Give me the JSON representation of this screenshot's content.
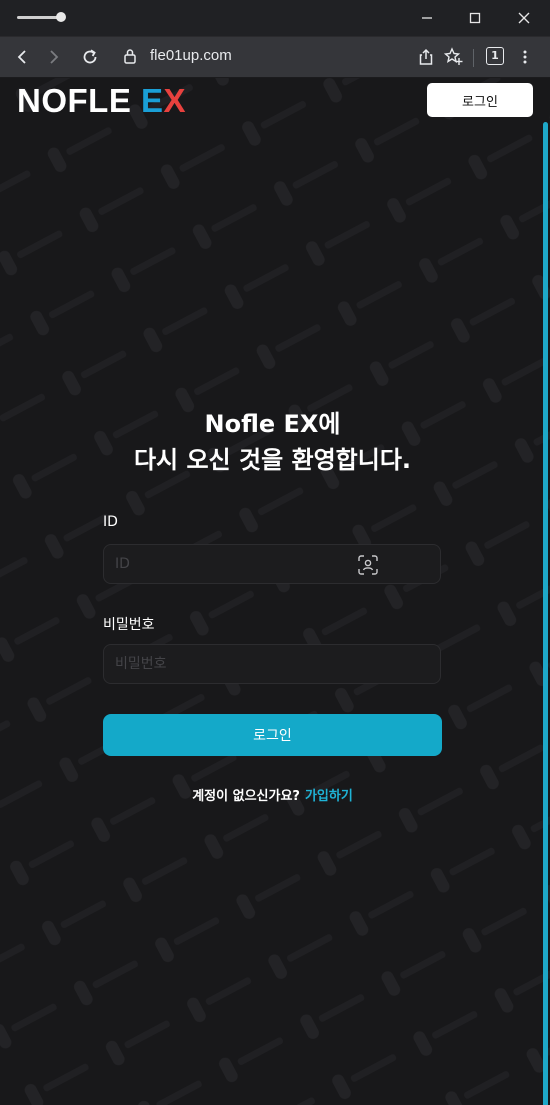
{
  "browser": {
    "url": "fle01up.com",
    "tab_count": "1"
  },
  "header": {
    "logo_main": "NOFLE ",
    "logo_e": "E",
    "logo_x": "X",
    "login_label": "로그인"
  },
  "hero": {
    "line1": "Nofle EX에",
    "line2": "다시 오신 것을 환영합니다."
  },
  "form": {
    "id_label": "ID",
    "id_placeholder": "ID",
    "id_value": "",
    "password_label": "비밀번호",
    "password_placeholder": "비밀번호",
    "password_value": "",
    "submit_label": "로그인"
  },
  "signup": {
    "question": "계정이 없으신가요?",
    "link": "가입하기"
  },
  "colors": {
    "accent": "#14a9c9",
    "logo_e": "#1a9fd6",
    "logo_x": "#e8413e",
    "background": "#18181a"
  }
}
